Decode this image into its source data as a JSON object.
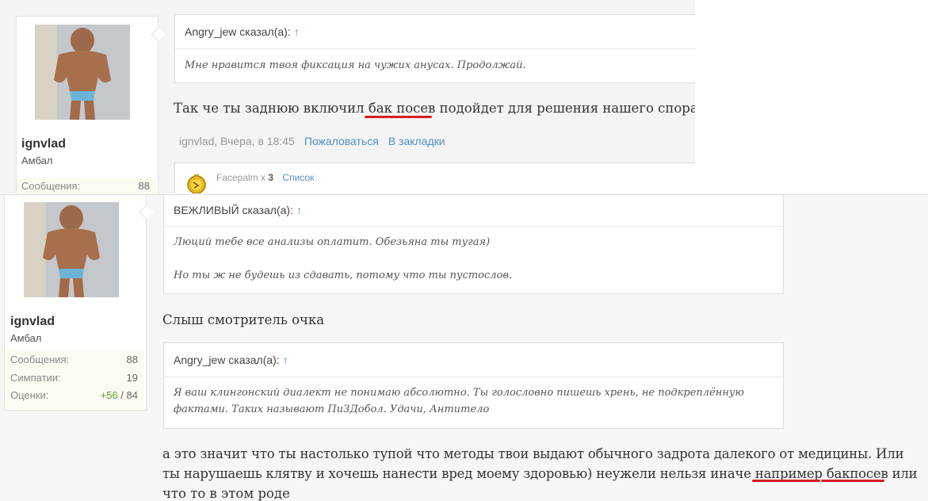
{
  "post1": {
    "user": {
      "name": "ignvlad",
      "title": "Амбал",
      "stat_label": "Сообщения:",
      "stat_value": "88"
    },
    "quote": {
      "author_line": "Angry_jew сказал(а):",
      "arrow": "↑",
      "text": "Мне нравится твоя фиксация на чужих анусах. Продолжай."
    },
    "message": {
      "before": "Так че ты заднюю включил ",
      "highlight": "бак посев",
      "after": " подойдет для решения нашего спора?"
    },
    "meta": {
      "author_time": "ignvlad, Вчера, в 18:45",
      "report": "Пожаловаться",
      "bookmark": "В закладки"
    },
    "likes": {
      "label": "Facepalm x",
      "count": "3",
      "list": "Список",
      "icon": "facepalm-medal-icon"
    }
  },
  "post2": {
    "user": {
      "name": "ignvlad",
      "title": "Амбал",
      "stats": [
        {
          "label": "Сообщения:",
          "value": "88"
        },
        {
          "label": "Симпатии:",
          "value": "19"
        },
        {
          "label": "Оценки:",
          "pos": "+56",
          "sep": " / ",
          "total": "84"
        }
      ]
    },
    "quote1": {
      "author_line": "ВЕЖЛИВЫЙ сказал(а):",
      "arrow": "↑",
      "line1": "Люций тебе все анализы оплатит. Обезьяна ты тугая)",
      "line2": "Но ты ж не будешь из сдавать, потому что ты пустослов."
    },
    "text1": "Слыш смотритель очка",
    "quote2": {
      "author_line": "Angry_jew сказал(а):",
      "arrow": "↑",
      "line1": "Я ваш клингонский диалект не понимаю абсолютно. Ты голословно пишешь хрень, не подкреплённую",
      "line2": "фактами. Таких называют ПиЗДобол. Удачи, Антитело"
    },
    "text2": {
      "line1": "а это значит что ты настолько тупой что методы твои выдают обычного задрота далекого от медицины. Или",
      "line2_before": "ты нарушаешь клятву и хочешь нанести вред моему здоровью) неужели нельзя иначе ",
      "line2_hl1": "например",
      "line2_space": " ",
      "line2_hl2": "бакпосев",
      "line2_after": " или",
      "line3": "что то в этом роде"
    }
  },
  "colors": {
    "link": "#4f8fc6",
    "positive": "#5aa02c",
    "annotation": "#d81e1e"
  }
}
